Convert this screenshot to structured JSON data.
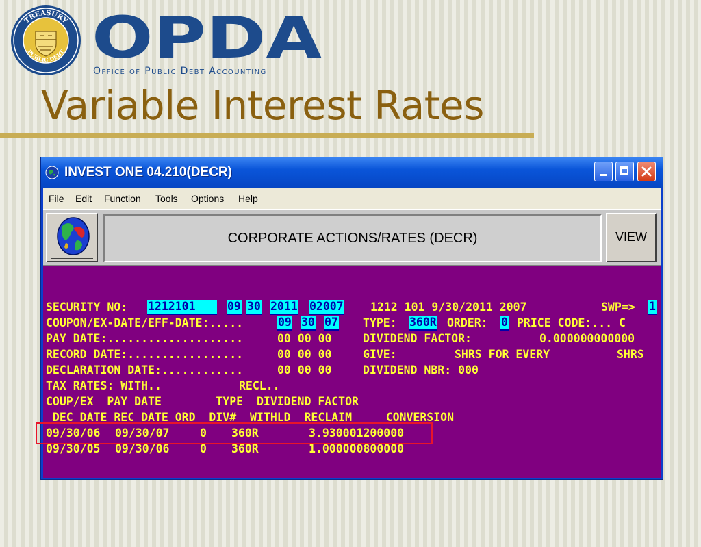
{
  "slide": {
    "seal_text_top": "TREASURY",
    "seal_text_bottom": "PUBLIC DEBT",
    "brand": "OPDA",
    "brand_subtitle": "Office of Public Debt Accounting",
    "title": "Variable Interest Rates",
    "colors": {
      "brand": "#1d4b8c",
      "title": "#8a6010",
      "rule": "#c8ad55",
      "highlight": "#e8152a"
    }
  },
  "window": {
    "title": "INVEST ONE 04.210(DECR)",
    "menu": [
      "File",
      "Edit",
      "Function",
      "Tools",
      "Options",
      "Help"
    ],
    "screen_title": "CORPORATE ACTIONS/RATES (DECR)",
    "view_label": "VIEW",
    "icons": [
      "app-icon",
      "globe-icon",
      "minimize-icon",
      "maximize-icon",
      "close-icon"
    ]
  },
  "terminal": {
    "security_label": "SECURITY NO:",
    "security_fields": [
      "1212101",
      "09",
      "30",
      "2011",
      "02007"
    ],
    "security_echo": "1212 101 9/30/2011 2007",
    "swp_label": "SWP=>",
    "swp_value": "1",
    "coupon_label": "COUPON/EX-DATE/EFF-DATE:.....",
    "coupon_fields": [
      "09",
      "30",
      "07"
    ],
    "type_label": "TYPE:",
    "type_value": "360R",
    "order_label": "ORDER:",
    "order_value": "0",
    "price_code": "PRICE CODE:... C",
    "pay_date_label": "PAY DATE:....................",
    "pay_date_value": "00 00 00",
    "dividend_factor_label": "DIVIDEND FACTOR:",
    "dividend_factor_value": "0.000000000000",
    "record_date_label": "RECORD DATE:.................",
    "record_date_value": "00 00 00",
    "give_label": "GIVE:",
    "give_middle": "SHRS FOR EVERY",
    "give_end": "SHRS",
    "declaration_label": "DECLARATION DATE:............",
    "declaration_value": "00 00 00",
    "dividend_nbr": "DIVIDEND NBR: 000",
    "tax_rates": "TAX RATES: WITH..",
    "recl": "RECL..",
    "header1": "COUP/EX  PAY DATE        TYPE  DIVIDEND FACTOR",
    "header2": " DEC DATE REC DATE ORD  DIV#  WITHLD  RECLAIM     CONVERSION",
    "rows": [
      {
        "dec_date": "09/30/06",
        "rec_date": "09/30/07",
        "ord": "0",
        "div": "360R",
        "factor": "3.930001200000"
      },
      {
        "dec_date": "09/30/05",
        "rec_date": "09/30/06",
        "ord": "0",
        "div": "360R",
        "factor": "1.000000800000"
      }
    ],
    "colors": {
      "background": "#800080",
      "text": "#ffff33",
      "field_bg": "#00ffff",
      "field_text": "#0000aa"
    }
  }
}
